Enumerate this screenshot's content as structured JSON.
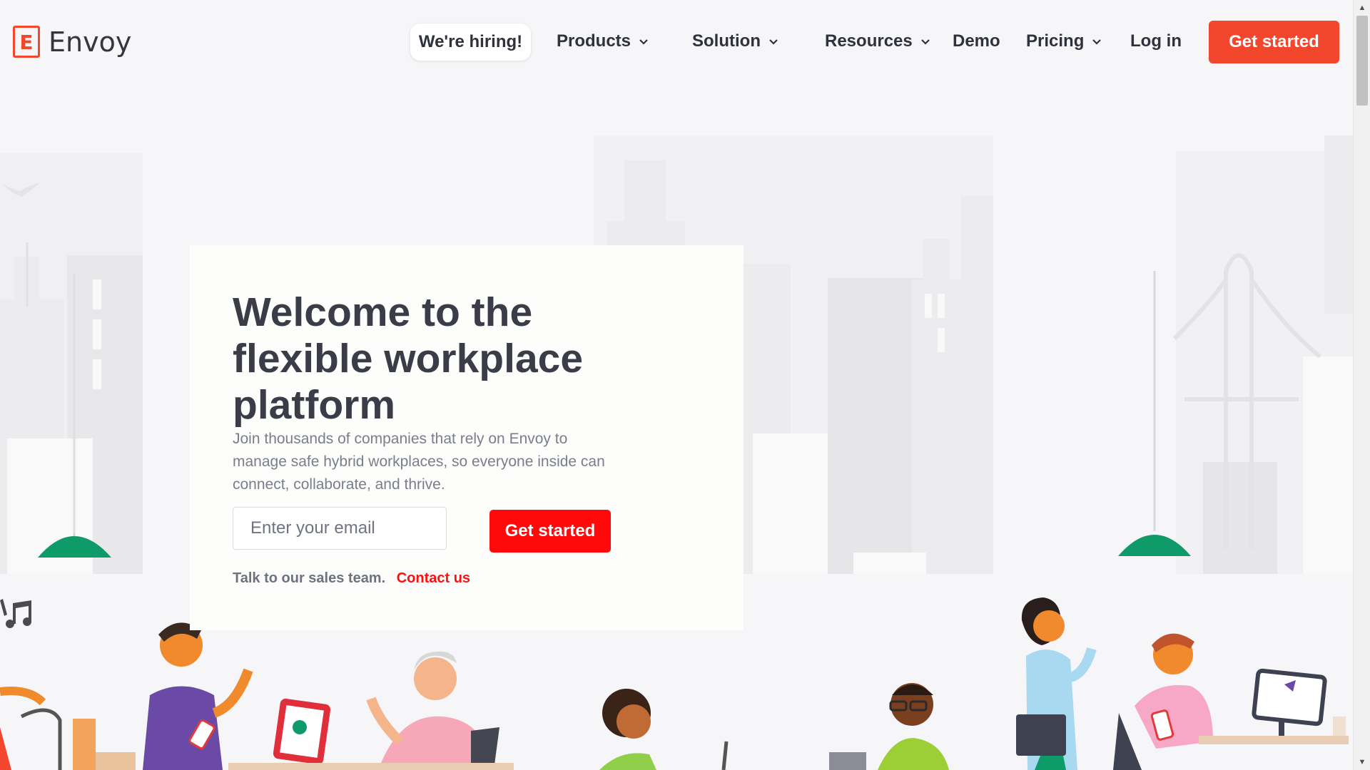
{
  "header": {
    "logo_letter": "E",
    "logo_text": "Envoy",
    "hiring_label": "We're hiring!",
    "nav": {
      "products": "Products",
      "solution": "Solution",
      "resources": "Resources",
      "demo": "Demo",
      "pricing": "Pricing",
      "login": "Log in"
    },
    "cta_label": "Get started"
  },
  "hero": {
    "title": "Welcome to the flexible workplace platform",
    "subtitle": "Join thousands of companies that rely on Envoy to manage safe hybrid workplaces, so everyone inside can connect, collaborate, and thrive.",
    "email_placeholder": "Enter your email",
    "email_value": "",
    "cta_label": "Get started",
    "sales_text": "Talk to our sales team.",
    "contact_label": "Contact us"
  },
  "colors": {
    "brand": "#f2462d",
    "cta_red": "#ff0a0a",
    "lamp_green": "#0f9a6a",
    "text_dark": "#3a3d48"
  },
  "icons": [
    "chevron-down-icon",
    "music-note-icon",
    "bird-icon",
    "scroll-up-arrow-icon",
    "scroll-down-arrow-icon"
  ]
}
